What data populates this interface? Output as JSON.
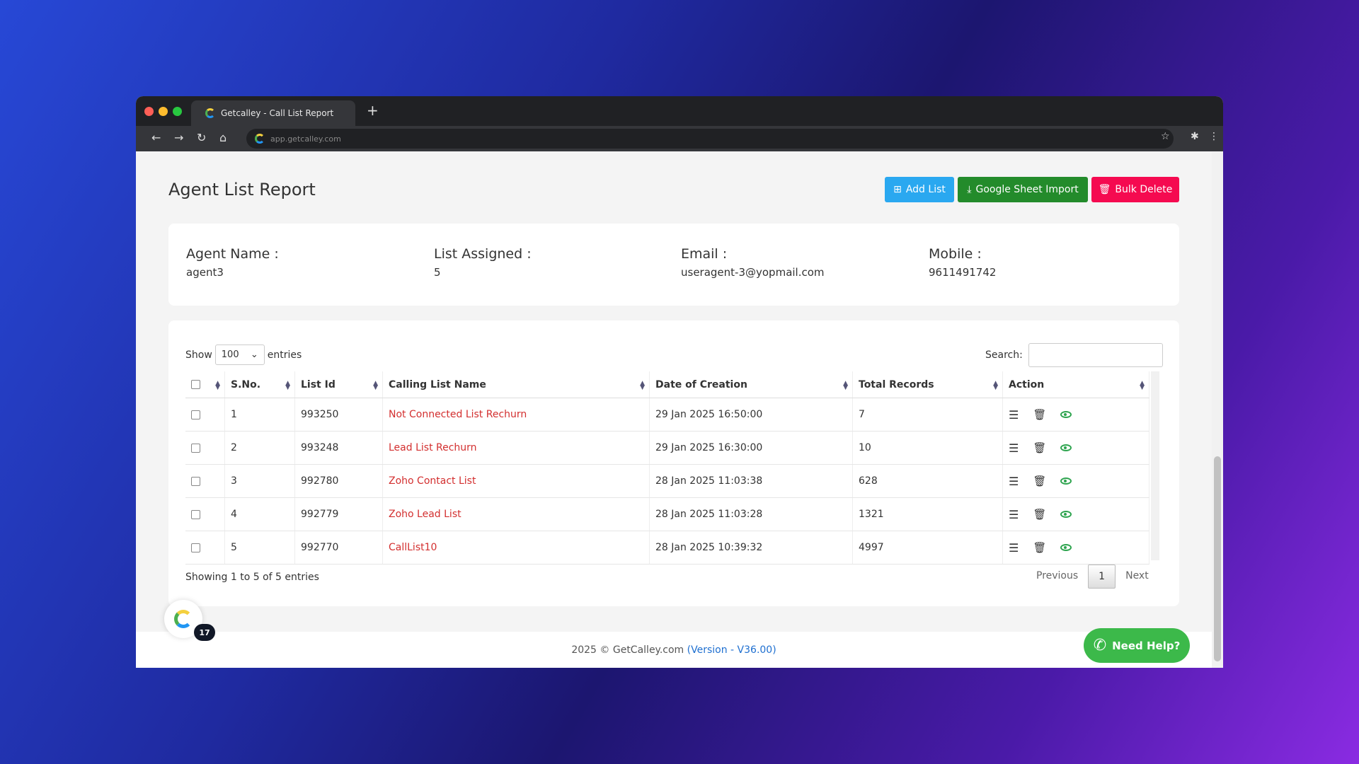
{
  "browser": {
    "tab_title": "Getcalley - Call List Report",
    "url": "app.getcalley.com"
  },
  "page": {
    "title": "Agent List Report"
  },
  "toolbar": {
    "add_list": "Add List",
    "google_import": "Google Sheet Import",
    "bulk_delete": "Bulk Delete"
  },
  "agent": {
    "name_label": "Agent Name :",
    "name": "agent3",
    "list_label": "List Assigned :",
    "list": "5",
    "email_label": "Email :",
    "email": "useragent-3@yopmail.com",
    "mobile_label": "Mobile :",
    "mobile": "9611491742"
  },
  "table": {
    "show": "Show",
    "entries_value": "100",
    "entries": "entries",
    "search_label": "Search:",
    "headers": [
      "S.No.",
      "List Id",
      "Calling List Name",
      "Date of Creation",
      "Total Records",
      "Action"
    ],
    "rows": [
      {
        "sno": "1",
        "id": "993250",
        "name": "Not Connected List Rechurn",
        "date": "29 Jan 2025 16:50:00",
        "total": "7"
      },
      {
        "sno": "2",
        "id": "993248",
        "name": "Lead List Rechurn",
        "date": "29 Jan 2025 16:30:00",
        "total": "10"
      },
      {
        "sno": "3",
        "id": "992780",
        "name": "Zoho Contact List",
        "date": "28 Jan 2025 11:03:38",
        "total": "628"
      },
      {
        "sno": "4",
        "id": "992779",
        "name": "Zoho Lead List",
        "date": "28 Jan 2025 11:03:28",
        "total": "1321"
      },
      {
        "sno": "5",
        "id": "992770",
        "name": "CallList10",
        "date": "28 Jan 2025 10:39:32",
        "total": "4997"
      }
    ],
    "info": "Showing 1 to 5 of 5 entries",
    "prev": "Previous",
    "page": "1",
    "next": "Next"
  },
  "widget": {
    "badge": "17",
    "help": "Need Help?"
  },
  "footer": {
    "copy": "2025 © GetCalley.com",
    "version": "(Version - V36.00)"
  }
}
